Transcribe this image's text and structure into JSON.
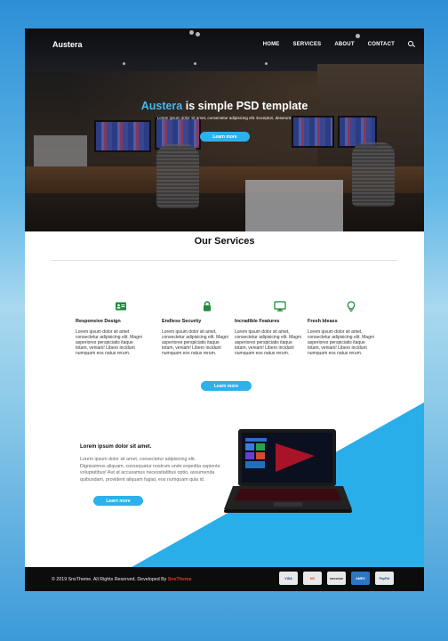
{
  "header": {
    "brand": "Austera",
    "nav": [
      "HOME",
      "SERVICES",
      "ABOUT",
      "CONTACT"
    ],
    "search_icon": "search-icon"
  },
  "hero": {
    "title_accent": "Austera",
    "title_rest": " is simple PSD template",
    "subtitle": "Lorem ipsum dolor sit amet, consectetur adipisicing elit. Excepturi, deserunt.",
    "button": "Learn more"
  },
  "services": {
    "title": "Our Services",
    "items": [
      {
        "icon": "id-card-icon",
        "title": "Responsive Design",
        "text": "Lorem ipsum dolor sit amet consectetur adipisicing elit. Magni asperiores perspiciatis itaque totam, veniam! Libero incidunt numquam eos natus rerum."
      },
      {
        "icon": "lock-icon",
        "title": "Endless Security",
        "text": "Lorem ipsum dolor sit amet, consectetur adipisicing elit. Magni asperiores perspiciatis itaque totam, veniam! Libero incidunt numquam eos natus rerum."
      },
      {
        "icon": "monitor-icon",
        "title": "Incradible Features",
        "text": "Lorem ipsum dolor sit amet, consectetur adipisicing elit. Magni asperiores perspiciatis itaque totam, veniam! Libero incidunt numquam eos natus rerum."
      },
      {
        "icon": "lightbulb-icon",
        "title": "Fresh Ideass",
        "text": "Lorem ipsum dolor sit amet, consectetur adipisicing elit. Magni asperiores perspiciatis itaque totam, veniam! Libero incidunt numquam eos natus rerum."
      }
    ],
    "button": "Learn more"
  },
  "product": {
    "title": "Lorem ipsum dolor sit amet.",
    "text": "Lorem ipsum dolor sit amet, consectetur adipisicing elit. Dignissimos aliquam, consequatur nostrum unde expedita sapiente voluptatibus! Aut at accusamus necessitatibus optio, assumenda quibusdam, provident aliquam fugiat, eos numquam quia id.",
    "button": "Learn more"
  },
  "footer": {
    "copy_prefix": "© 2019 SnsTheme. All Rights Reserved. Developed By ",
    "copy_brand": "SnsTheme",
    "payments": [
      "VISA",
      "MC",
      "DISCOVER",
      "AMEX",
      "PayPal"
    ]
  },
  "colors": {
    "accent": "#2cb1ea",
    "icon_green": "#1f8a3b",
    "footer_bg": "#0c0c0c",
    "footer_brand": "#e23a2a"
  }
}
